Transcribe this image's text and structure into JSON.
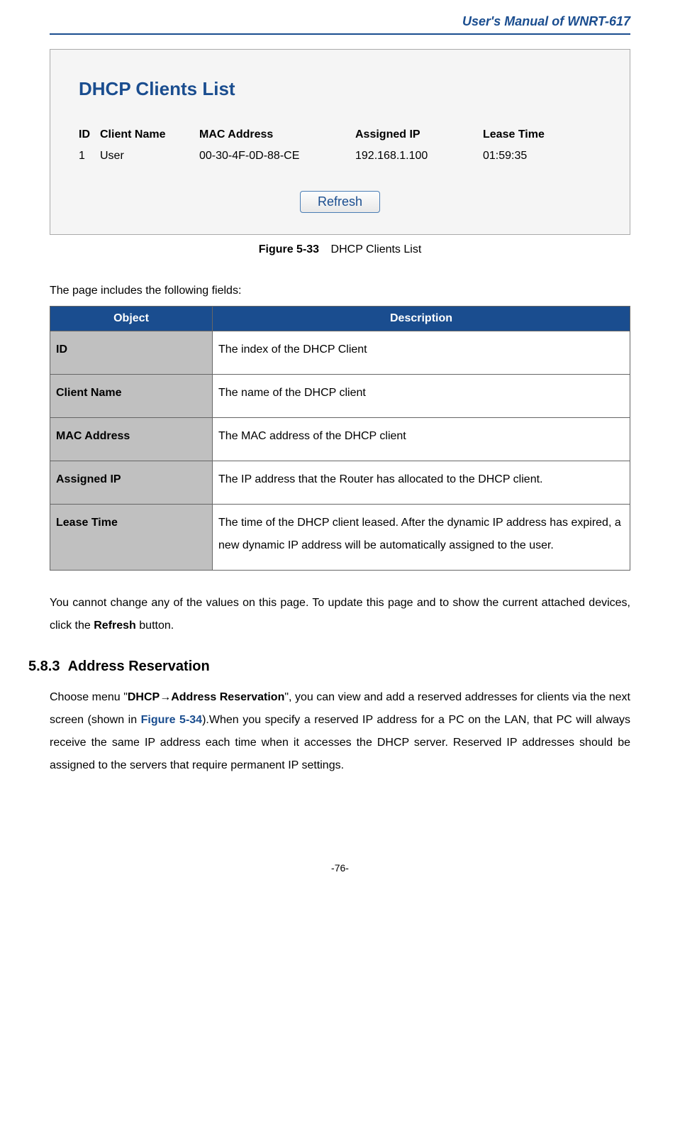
{
  "header": {
    "title": "User's  Manual  of  WNRT-617"
  },
  "screenshot": {
    "title": "DHCP Clients List",
    "columns": {
      "id": "ID",
      "name": "Client Name",
      "mac": "MAC Address",
      "ip": "Assigned IP",
      "lease": "Lease Time"
    },
    "row": {
      "id": "1",
      "name": "User",
      "mac": "00-30-4F-0D-88-CE",
      "ip": "192.168.1.100",
      "lease": "01:59:35"
    },
    "refresh": "Refresh"
  },
  "figure": {
    "label": "Figure 5-33",
    "caption": "DHCP Clients List"
  },
  "intro": "The page includes the following fields:",
  "table": {
    "headers": {
      "object": "Object",
      "description": "Description"
    },
    "rows": [
      {
        "object": "ID",
        "description": "The index of the DHCP Client"
      },
      {
        "object": "Client Name",
        "description": "The name of the DHCP client"
      },
      {
        "object": "MAC Address",
        "description": "The MAC address of the DHCP client"
      },
      {
        "object": "Assigned IP",
        "description": "The IP address that the Router has allocated to the DHCP client."
      },
      {
        "object": "Lease Time",
        "description": "The time of the DHCP client leased. After the dynamic IP address has expired, a new dynamic IP address will be automatically assigned to the user."
      }
    ]
  },
  "para1": {
    "p1": "You cannot change any of the values on this page. To update this page and to show the current attached devices, click the ",
    "bold": "Refresh",
    "p2": " button."
  },
  "section": {
    "number": "5.8.3",
    "title": "Address Reservation"
  },
  "para2": {
    "p1": "Choose menu \"",
    "b1": "DHCP→Address Reservation",
    "p2": "\", you can view and add a reserved addresses for clients via the next screen (shown in ",
    "link": "Figure 5-34",
    "p3": ").When you specify a reserved IP address for a PC on the LAN, that PC will always receive the same IP address each time when it accesses the DHCP server. Reserved IP addresses should be assigned to the servers that require permanent IP settings."
  },
  "page": "-76-"
}
